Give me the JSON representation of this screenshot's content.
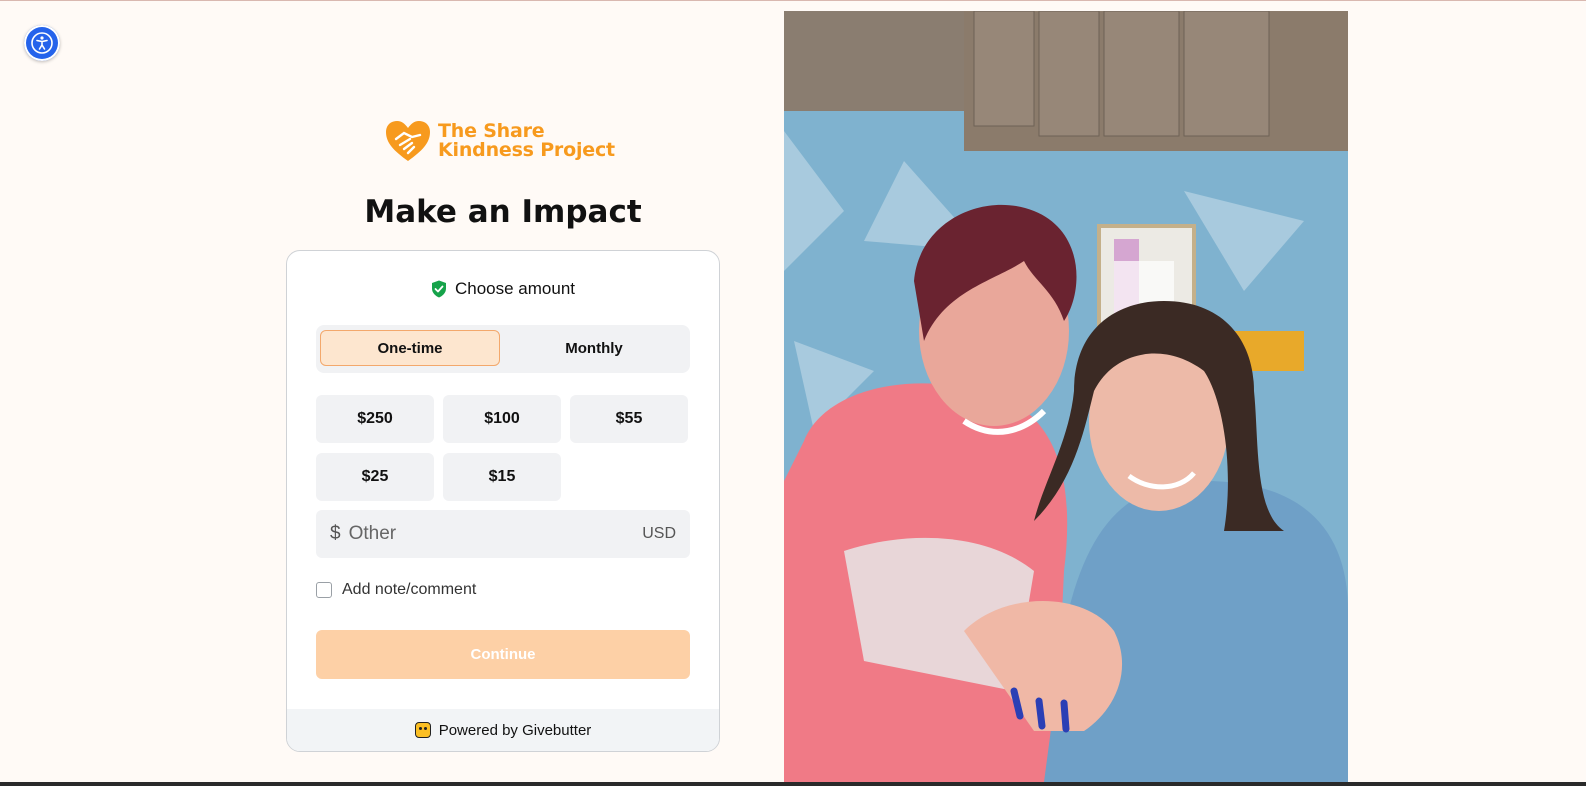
{
  "accessibility": {
    "icon": "accessibility-icon"
  },
  "brand": {
    "line1": "The Share",
    "line2": "Kindness Project",
    "color": "#f79a1e"
  },
  "headline": "Make an Impact",
  "form": {
    "choose_label": "Choose amount",
    "frequency": {
      "one_time": "One-time",
      "monthly": "Monthly",
      "selected": "One-time"
    },
    "amounts": [
      "$250",
      "$100",
      "$55",
      "$25",
      "$15"
    ],
    "other": {
      "currency_symbol": "$",
      "placeholder": "Other",
      "currency": "USD",
      "value": ""
    },
    "note_label": "Add note/comment",
    "continue_label": "Continue",
    "powered_by": "Powered by Givebutter"
  },
  "colors": {
    "accent": "#f79a1e",
    "selected_bg": "#fde6cf",
    "continue_bg": "#fdd0a6",
    "a11y_blue": "#2563eb",
    "shield_green": "#16a34a"
  }
}
